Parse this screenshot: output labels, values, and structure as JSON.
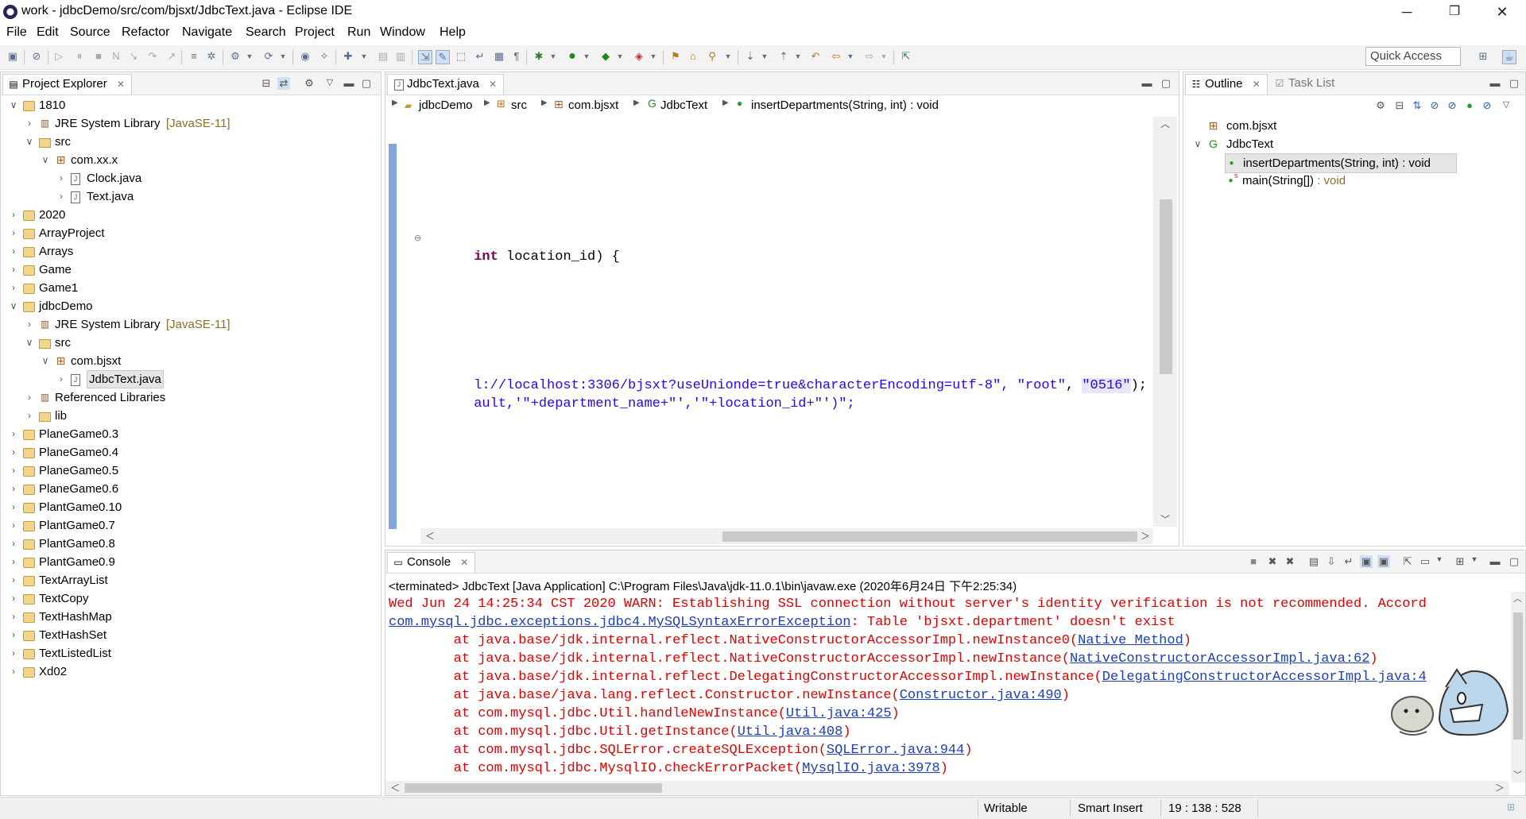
{
  "window": {
    "title": "work - jdbcDemo/src/com/bjsxt/JdbcText.java - Eclipse IDE",
    "minimize": "─",
    "restore": "❐",
    "close": "✕"
  },
  "menu": [
    "File",
    "Edit",
    "Source",
    "Refactor",
    "Navigate",
    "Search",
    "Project",
    "Run",
    "Window",
    "Help"
  ],
  "toolbar": {
    "quick_access_placeholder": "Quick Access"
  },
  "project_explorer": {
    "tab_label": "Project Explorer",
    "items": [
      {
        "label": "1810",
        "expanded": true,
        "level": 0,
        "icon": "project"
      },
      {
        "label": "JRE System Library",
        "suffix": "[JavaSE-11]",
        "level": 1,
        "icon": "library"
      },
      {
        "label": "src",
        "expanded": true,
        "level": 1,
        "icon": "src-folder"
      },
      {
        "label": "com.xx.x",
        "expanded": true,
        "level": 2,
        "icon": "package"
      },
      {
        "label": "Clock.java",
        "level": 3,
        "icon": "java-file"
      },
      {
        "label": "Text.java",
        "level": 3,
        "icon": "java-file"
      },
      {
        "label": "2020",
        "level": 0,
        "icon": "project"
      },
      {
        "label": "ArrayProject",
        "level": 0,
        "icon": "project"
      },
      {
        "label": "Arrays",
        "level": 0,
        "icon": "project"
      },
      {
        "label": "Game",
        "level": 0,
        "icon": "project"
      },
      {
        "label": "Game1",
        "level": 0,
        "icon": "project"
      },
      {
        "label": "jdbcDemo",
        "expanded": true,
        "level": 0,
        "icon": "project"
      },
      {
        "label": "JRE System Library",
        "suffix": "[JavaSE-11]",
        "level": 1,
        "icon": "library"
      },
      {
        "label": "src",
        "expanded": true,
        "level": 1,
        "icon": "src-folder"
      },
      {
        "label": "com.bjsxt",
        "expanded": true,
        "level": 2,
        "icon": "package"
      },
      {
        "label": "JdbcText.java",
        "level": 3,
        "icon": "java-file",
        "selected": true
      },
      {
        "label": "Referenced Libraries",
        "level": 1,
        "icon": "library"
      },
      {
        "label": "lib",
        "level": 1,
        "icon": "folder"
      },
      {
        "label": "PlaneGame0.3",
        "level": 0,
        "icon": "project"
      },
      {
        "label": "PlaneGame0.4",
        "level": 0,
        "icon": "project"
      },
      {
        "label": "PlaneGame0.5",
        "level": 0,
        "icon": "project"
      },
      {
        "label": "PlaneGame0.6",
        "level": 0,
        "icon": "project"
      },
      {
        "label": "PlantGame0.10",
        "level": 0,
        "icon": "project"
      },
      {
        "label": "PlantGame0.7",
        "level": 0,
        "icon": "project"
      },
      {
        "label": "PlantGame0.8",
        "level": 0,
        "icon": "project"
      },
      {
        "label": "PlantGame0.9",
        "level": 0,
        "icon": "project"
      },
      {
        "label": "TextArrayList",
        "level": 0,
        "icon": "project"
      },
      {
        "label": "TextCopy",
        "level": 0,
        "icon": "project"
      },
      {
        "label": "TextHashMap",
        "level": 0,
        "icon": "project"
      },
      {
        "label": "TextHashSet",
        "level": 0,
        "icon": "project"
      },
      {
        "label": "TextListedList",
        "level": 0,
        "icon": "project"
      },
      {
        "label": "Xd02",
        "level": 0,
        "icon": "project"
      }
    ]
  },
  "editor": {
    "tab_label": "JdbcText.java",
    "breadcrumb": [
      "jdbcDemo",
      "src",
      "com.bjsxt",
      "JdbcText",
      "insertDepartments(String, int) : void"
    ],
    "lines": {
      "line1_kw": "int",
      "line1_rest": " location_id) {",
      "line2_text": "l://localhost:3306/bjsxt?useUnionde=true&characterEncoding=utf-8\", ",
      "line2_s1": "\"root\"",
      "line2_mid": ", ",
      "line2_s2": "\"0516\"",
      "line2_end": ");",
      "line3_text": "ault,'\"+department_name+\"','\"+location_id+\"')\";"
    }
  },
  "outline": {
    "tab_label": "Outline",
    "tasklist_label": "Task List",
    "items": [
      {
        "label": "com.bjsxt",
        "icon": "package"
      },
      {
        "label": "JdbcText",
        "icon": "class"
      },
      {
        "label": "insertDepartments(String, int) : void",
        "icon": "public-method",
        "selected": true
      },
      {
        "label": "main(String[])",
        "suffix": " : void",
        "icon": "static-method"
      }
    ]
  },
  "console": {
    "tab_label": "Console",
    "header": "<terminated> JdbcText [Java Application] C:\\Program Files\\Java\\jdk-11.0.1\\bin\\javaw.exe (2020年6月24日 下午2:25:34)",
    "line1": "Wed Jun 24 14:25:34 CST 2020 WARN: Establishing SSL connection without server's identity verification is not recommended. Accord",
    "line2_link": "com.mysql.jdbc.exceptions.jdbc4.MySQLSyntaxErrorException",
    "line2_rest": ": Table 'bjsxt.department' doesn't exist",
    "stack": [
      {
        "text": "\tat java.base/jdk.internal.reflect.NativeConstructorAccessorImpl.newInstance0(",
        "link": "Native Method",
        "end": ")"
      },
      {
        "text": "\tat java.base/jdk.internal.reflect.NativeConstructorAccessorImpl.newInstance(",
        "link": "NativeConstructorAccessorImpl.java:62",
        "end": ")"
      },
      {
        "text": "\tat java.base/jdk.internal.reflect.DelegatingConstructorAccessorImpl.newInstance(",
        "link": "DelegatingConstructorAccessorImpl.java:4",
        "end": ""
      },
      {
        "text": "\tat java.base/java.lang.reflect.Constructor.newInstance(",
        "link": "Constructor.java:490",
        "end": ")"
      },
      {
        "text": "\tat com.mysql.jdbc.Util.handleNewInstance(",
        "link": "Util.java:425",
        "end": ")"
      },
      {
        "text": "\tat com.mysql.jdbc.Util.getInstance(",
        "link": "Util.java:408",
        "end": ")"
      },
      {
        "text": "\tat com.mysql.jdbc.SQLError.createSQLException(",
        "link": "SQLError.java:944",
        "end": ")"
      },
      {
        "text": "\tat com.mysql.jdbc.MysqlIO.checkErrorPacket(",
        "link": "MysqlIO.java:3978",
        "end": ")"
      }
    ]
  },
  "status": {
    "mode": "Writable",
    "insert": "Smart Insert",
    "position": "19 : 138 : 528"
  },
  "colors": {
    "keyword": "#7f0055",
    "string": "#2a00ff",
    "error": "#e00000",
    "link": "#1a3ebd"
  }
}
